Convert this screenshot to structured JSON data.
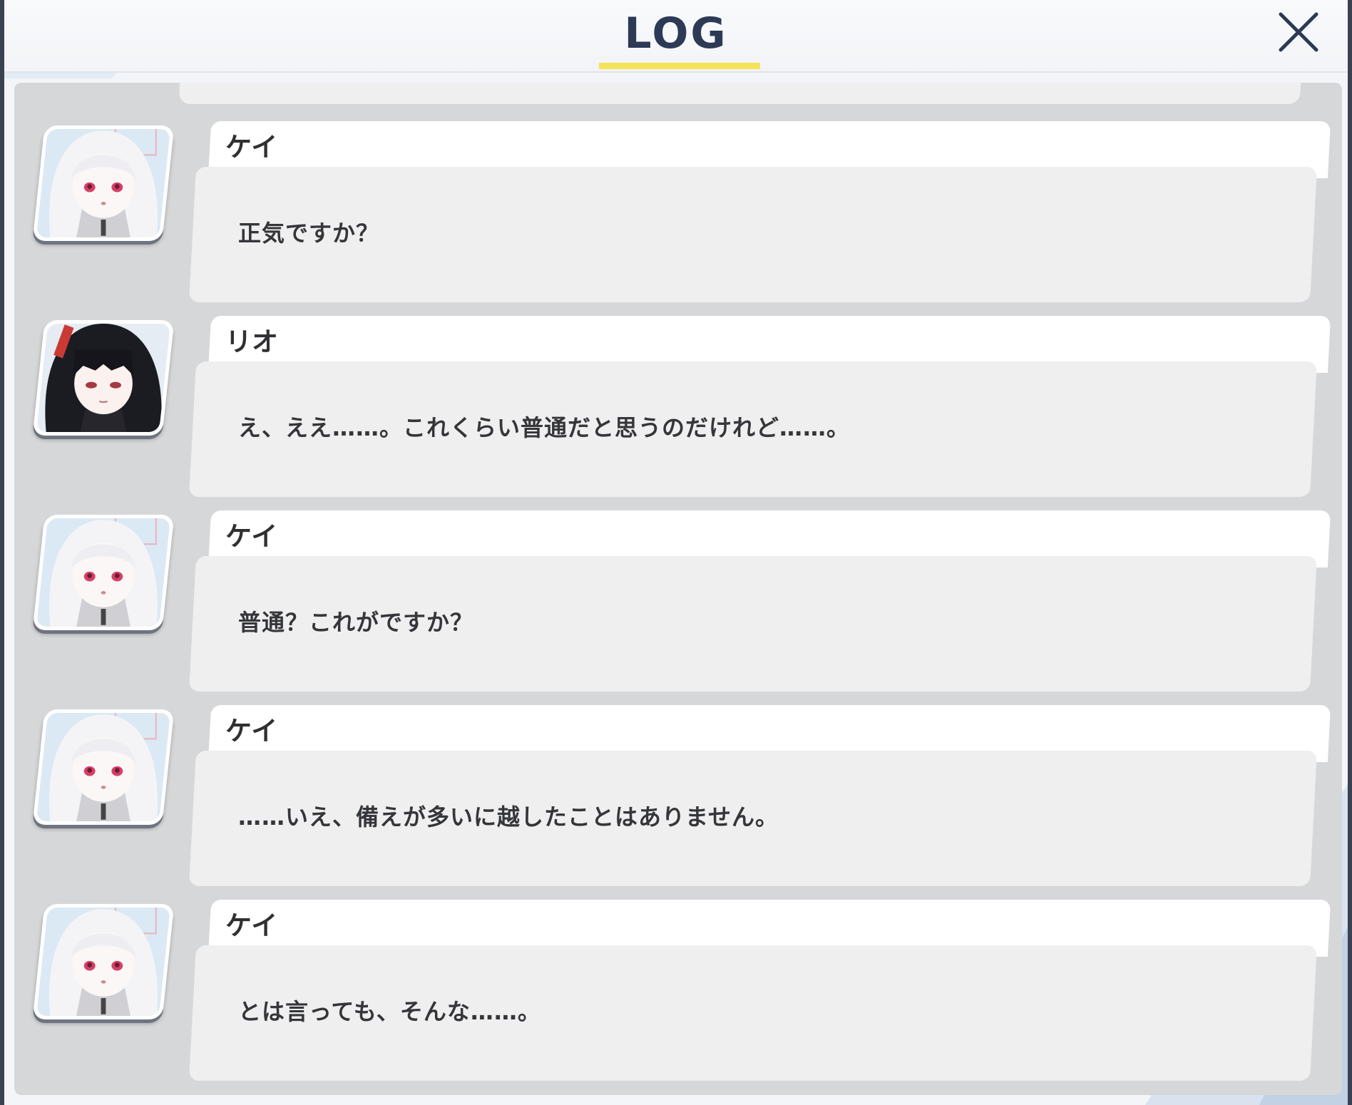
{
  "header": {
    "title": "LOG",
    "close_icon": "close-icon"
  },
  "colors": {
    "title": "#2c3a55",
    "underline_accent": "#f5e35a",
    "panel_bg": "#d6d7d9",
    "name_tab_bg": "#ffffff",
    "text_box_bg": "#efefef",
    "text": "#35363a"
  },
  "entries": [
    {
      "speaker": "ケイ",
      "avatar": "kei-portrait-icon",
      "message": "正気ですか？"
    },
    {
      "speaker": "リオ",
      "avatar": "rio-portrait-icon",
      "message": "え、ええ……。これくらい普通だと思うのだけれど……。"
    },
    {
      "speaker": "ケイ",
      "avatar": "kei-portrait-icon",
      "message": "普通？これがですか？"
    },
    {
      "speaker": "ケイ",
      "avatar": "kei-portrait-icon",
      "message": "……いえ、備えが多いに越したことはありません。"
    },
    {
      "speaker": "ケイ",
      "avatar": "kei-portrait-icon",
      "message": "とは言っても、そんな……。"
    }
  ]
}
